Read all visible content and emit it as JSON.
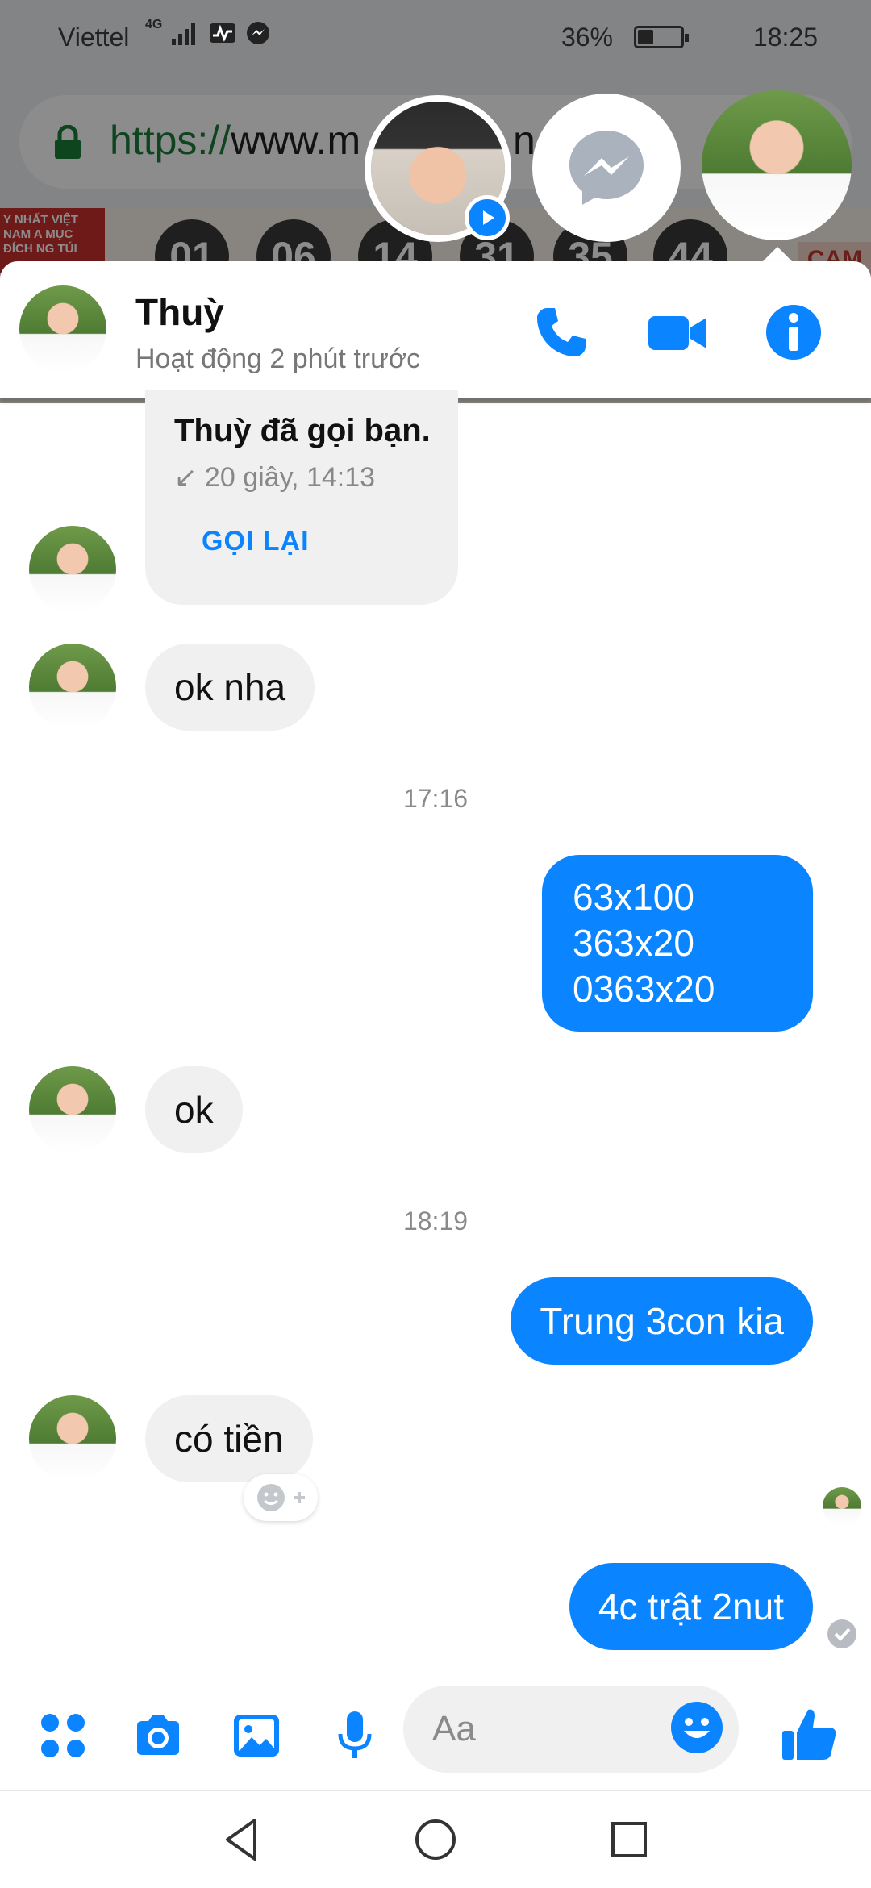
{
  "status_bar": {
    "carrier": "Viettel",
    "network": "4G",
    "battery_percent": "36%",
    "battery_level": 0.36,
    "time": "18:25"
  },
  "browser_background": {
    "url_scheme": "https://",
    "url_rest": "www.m",
    "url_tail": "n",
    "banner_text": "Y NHẤT VIỆT NAM A MỤC ĐÍCH NG TÚI",
    "numbers": [
      "01",
      "06",
      "14",
      "31",
      "35",
      "44"
    ],
    "side_label": "CAM"
  },
  "chat_heads": [
    {
      "icon": "avatar-photo"
    },
    {
      "icon": "messenger-icon"
    },
    {
      "icon": "avatar-photo"
    }
  ],
  "header": {
    "name": "Thuỳ",
    "status": "Hoạt động 2 phút trước",
    "call_icon": "phone-icon",
    "video_icon": "video-camera-icon",
    "info_icon": "info-icon"
  },
  "call_card": {
    "title": "Thuỳ đã gọi bạn.",
    "meta": "↙ 20 giây, 14:13",
    "call_back": "GỌI LẠI"
  },
  "messages": {
    "m1": "ok nha",
    "t1": "17:16",
    "m2_lines": [
      "63x100",
      "363x20",
      "0363x20"
    ],
    "m3": "ok",
    "t2": "18:19",
    "m4": "Trung 3con kia",
    "m5": "có tiền",
    "m6": "4c trật 2nut"
  },
  "composer": {
    "placeholder": "Aa",
    "value": ""
  },
  "colors": {
    "accent": "#0a84ff",
    "incoming_bubble": "#f0f0f0",
    "timestamp": "#8a8a8a"
  }
}
